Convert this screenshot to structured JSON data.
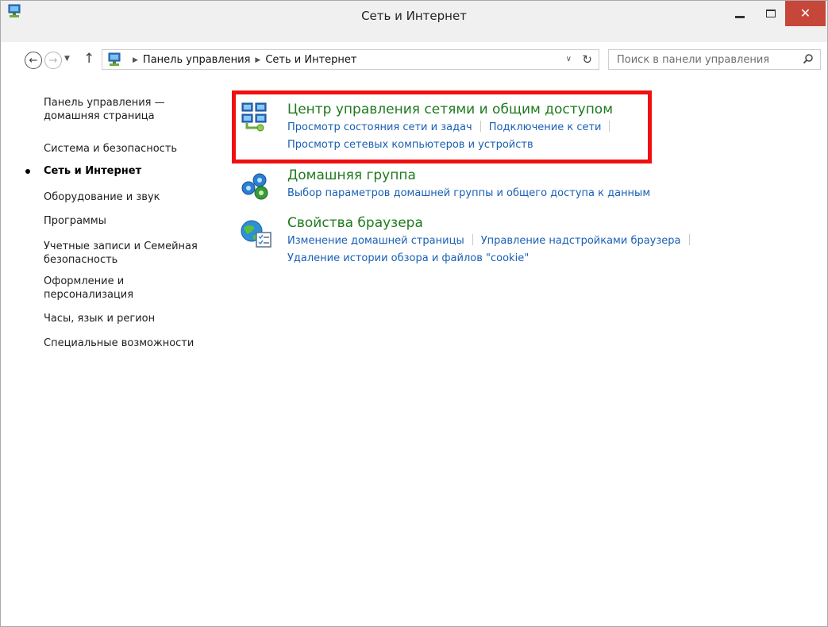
{
  "window": {
    "title": "Сеть и Интернет"
  },
  "address": {
    "crumbs": [
      "Панель управления",
      "Сеть и Интернет"
    ]
  },
  "search": {
    "placeholder": "Поиск в панели управления"
  },
  "leftnav": {
    "items": [
      {
        "label": "Панель управления — домашняя страница"
      },
      {
        "label": "Система и безопасность"
      },
      {
        "label": "Сеть и Интернет",
        "current": true
      },
      {
        "label": "Оборудование и звук"
      },
      {
        "label": "Программы"
      },
      {
        "label": "Учетные записи и Семейная безопасность"
      },
      {
        "label": "Оформление и персонализация"
      },
      {
        "label": "Часы, язык и регион"
      },
      {
        "label": "Специальные возможности"
      }
    ]
  },
  "categories": [
    {
      "icon": "network-sharing-center-icon",
      "title": "Центр управления сетями и общим доступом",
      "links": [
        "Просмотр состояния сети и задач",
        "Подключение к сети",
        "Просмотр сетевых компьютеров и устройств"
      ]
    },
    {
      "icon": "homegroup-icon",
      "title": "Домашняя группа",
      "links": [
        "Выбор параметров домашней группы и общего доступа к данным"
      ]
    },
    {
      "icon": "internet-options-icon",
      "title": "Свойства браузера",
      "links": [
        "Изменение домашней страницы",
        "Управление надстройками браузера",
        "Удаление истории обзора и файлов \"cookie\""
      ]
    }
  ],
  "highlight_color": "#ee1111",
  "accent_colors": {
    "category_title": "#1e7a1e",
    "link": "#1a5fb4",
    "close_button": "#c7463a"
  }
}
